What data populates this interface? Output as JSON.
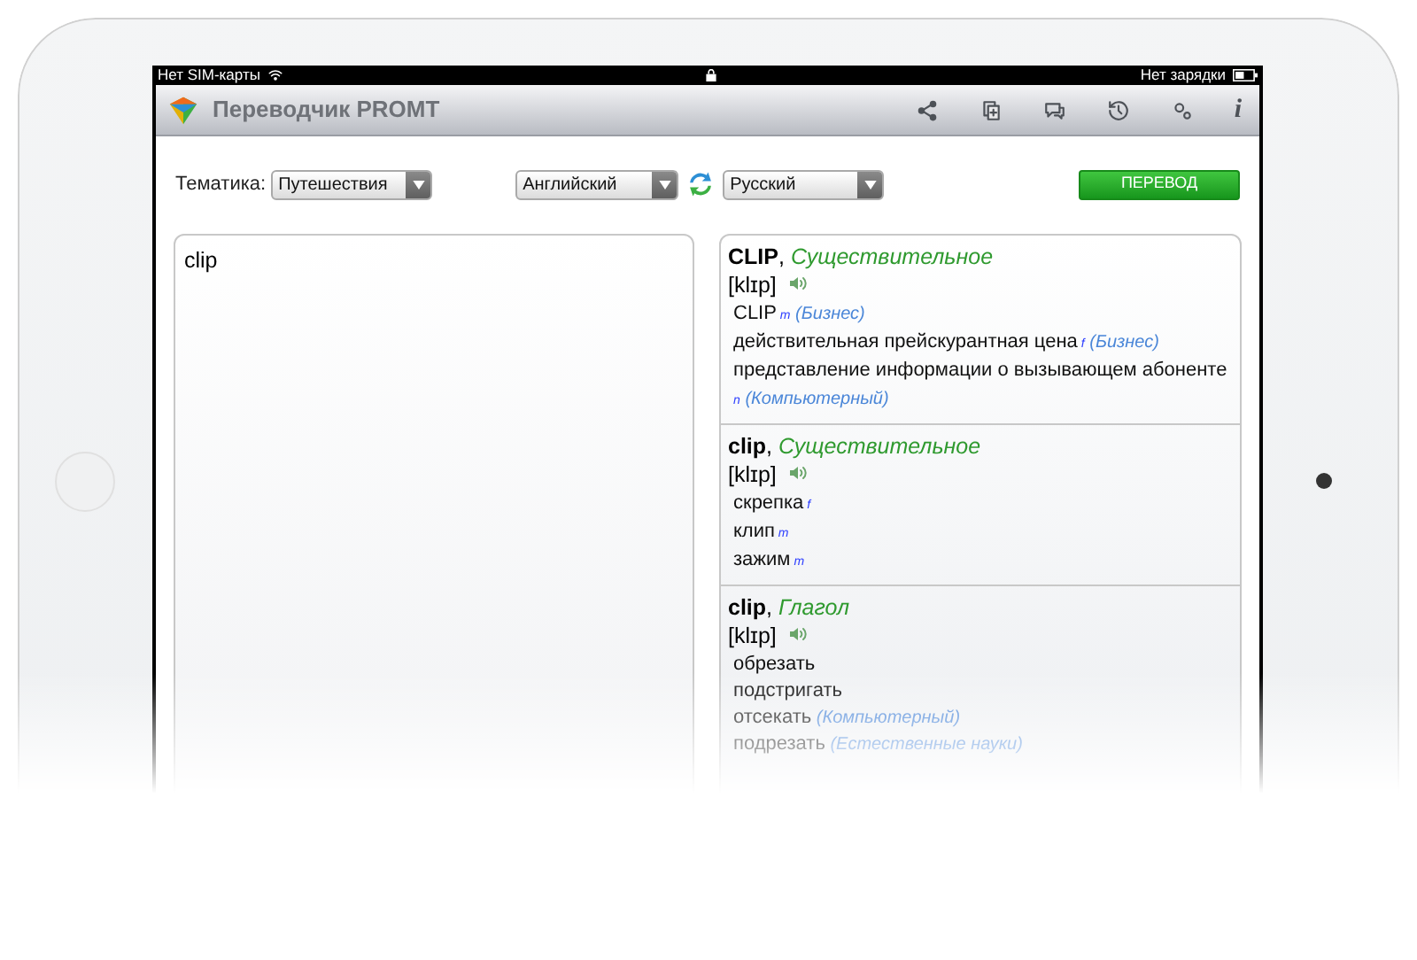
{
  "status_bar": {
    "carrier": "Нет SIM-карты",
    "battery": "Нет зарядки"
  },
  "toolbar": {
    "title": "Переводчик PROMT",
    "info": "i"
  },
  "controls": {
    "topic_label": "Тематика:",
    "topic": "Путешествия",
    "source_language": "Английский",
    "target_language": "Русский",
    "translate_button": "ПЕРЕВОД"
  },
  "input": {
    "value": "clip"
  },
  "entries": [
    {
      "heading": "**CLIP**, *Существительное*",
      "transcription": "[klɪp]",
      "translations": [
        {
          "text": "CLIP",
          "gender": "m",
          "domain": "(Бизнес)"
        },
        {
          "text": "действительная прейскурантная цена",
          "gender": "f",
          "domain": "(Бизнес)"
        },
        {
          "text": "представление информации о вызывающем абоненте",
          "gender": "n",
          "domain": "(Компьютерный)"
        }
      ]
    },
    {
      "heading": "**clip**, *Существительное*",
      "transcription": "[klɪp]",
      "translations": [
        {
          "text": "скрепка",
          "gender": "f"
        },
        {
          "text": "клип",
          "gender": "m"
        },
        {
          "text": "зажим",
          "gender": "m"
        }
      ]
    },
    {
      "heading": "**clip**, *Глагол*",
      "transcription": "[klɪp]",
      "translations": [
        {
          "text": "обрезать"
        },
        {
          "text": "подстригать"
        },
        {
          "text": "отсекать",
          "domain": "(Компьютерный)"
        },
        {
          "text": "подрезать",
          "domain": "(Естественные науки)"
        }
      ]
    }
  ]
}
